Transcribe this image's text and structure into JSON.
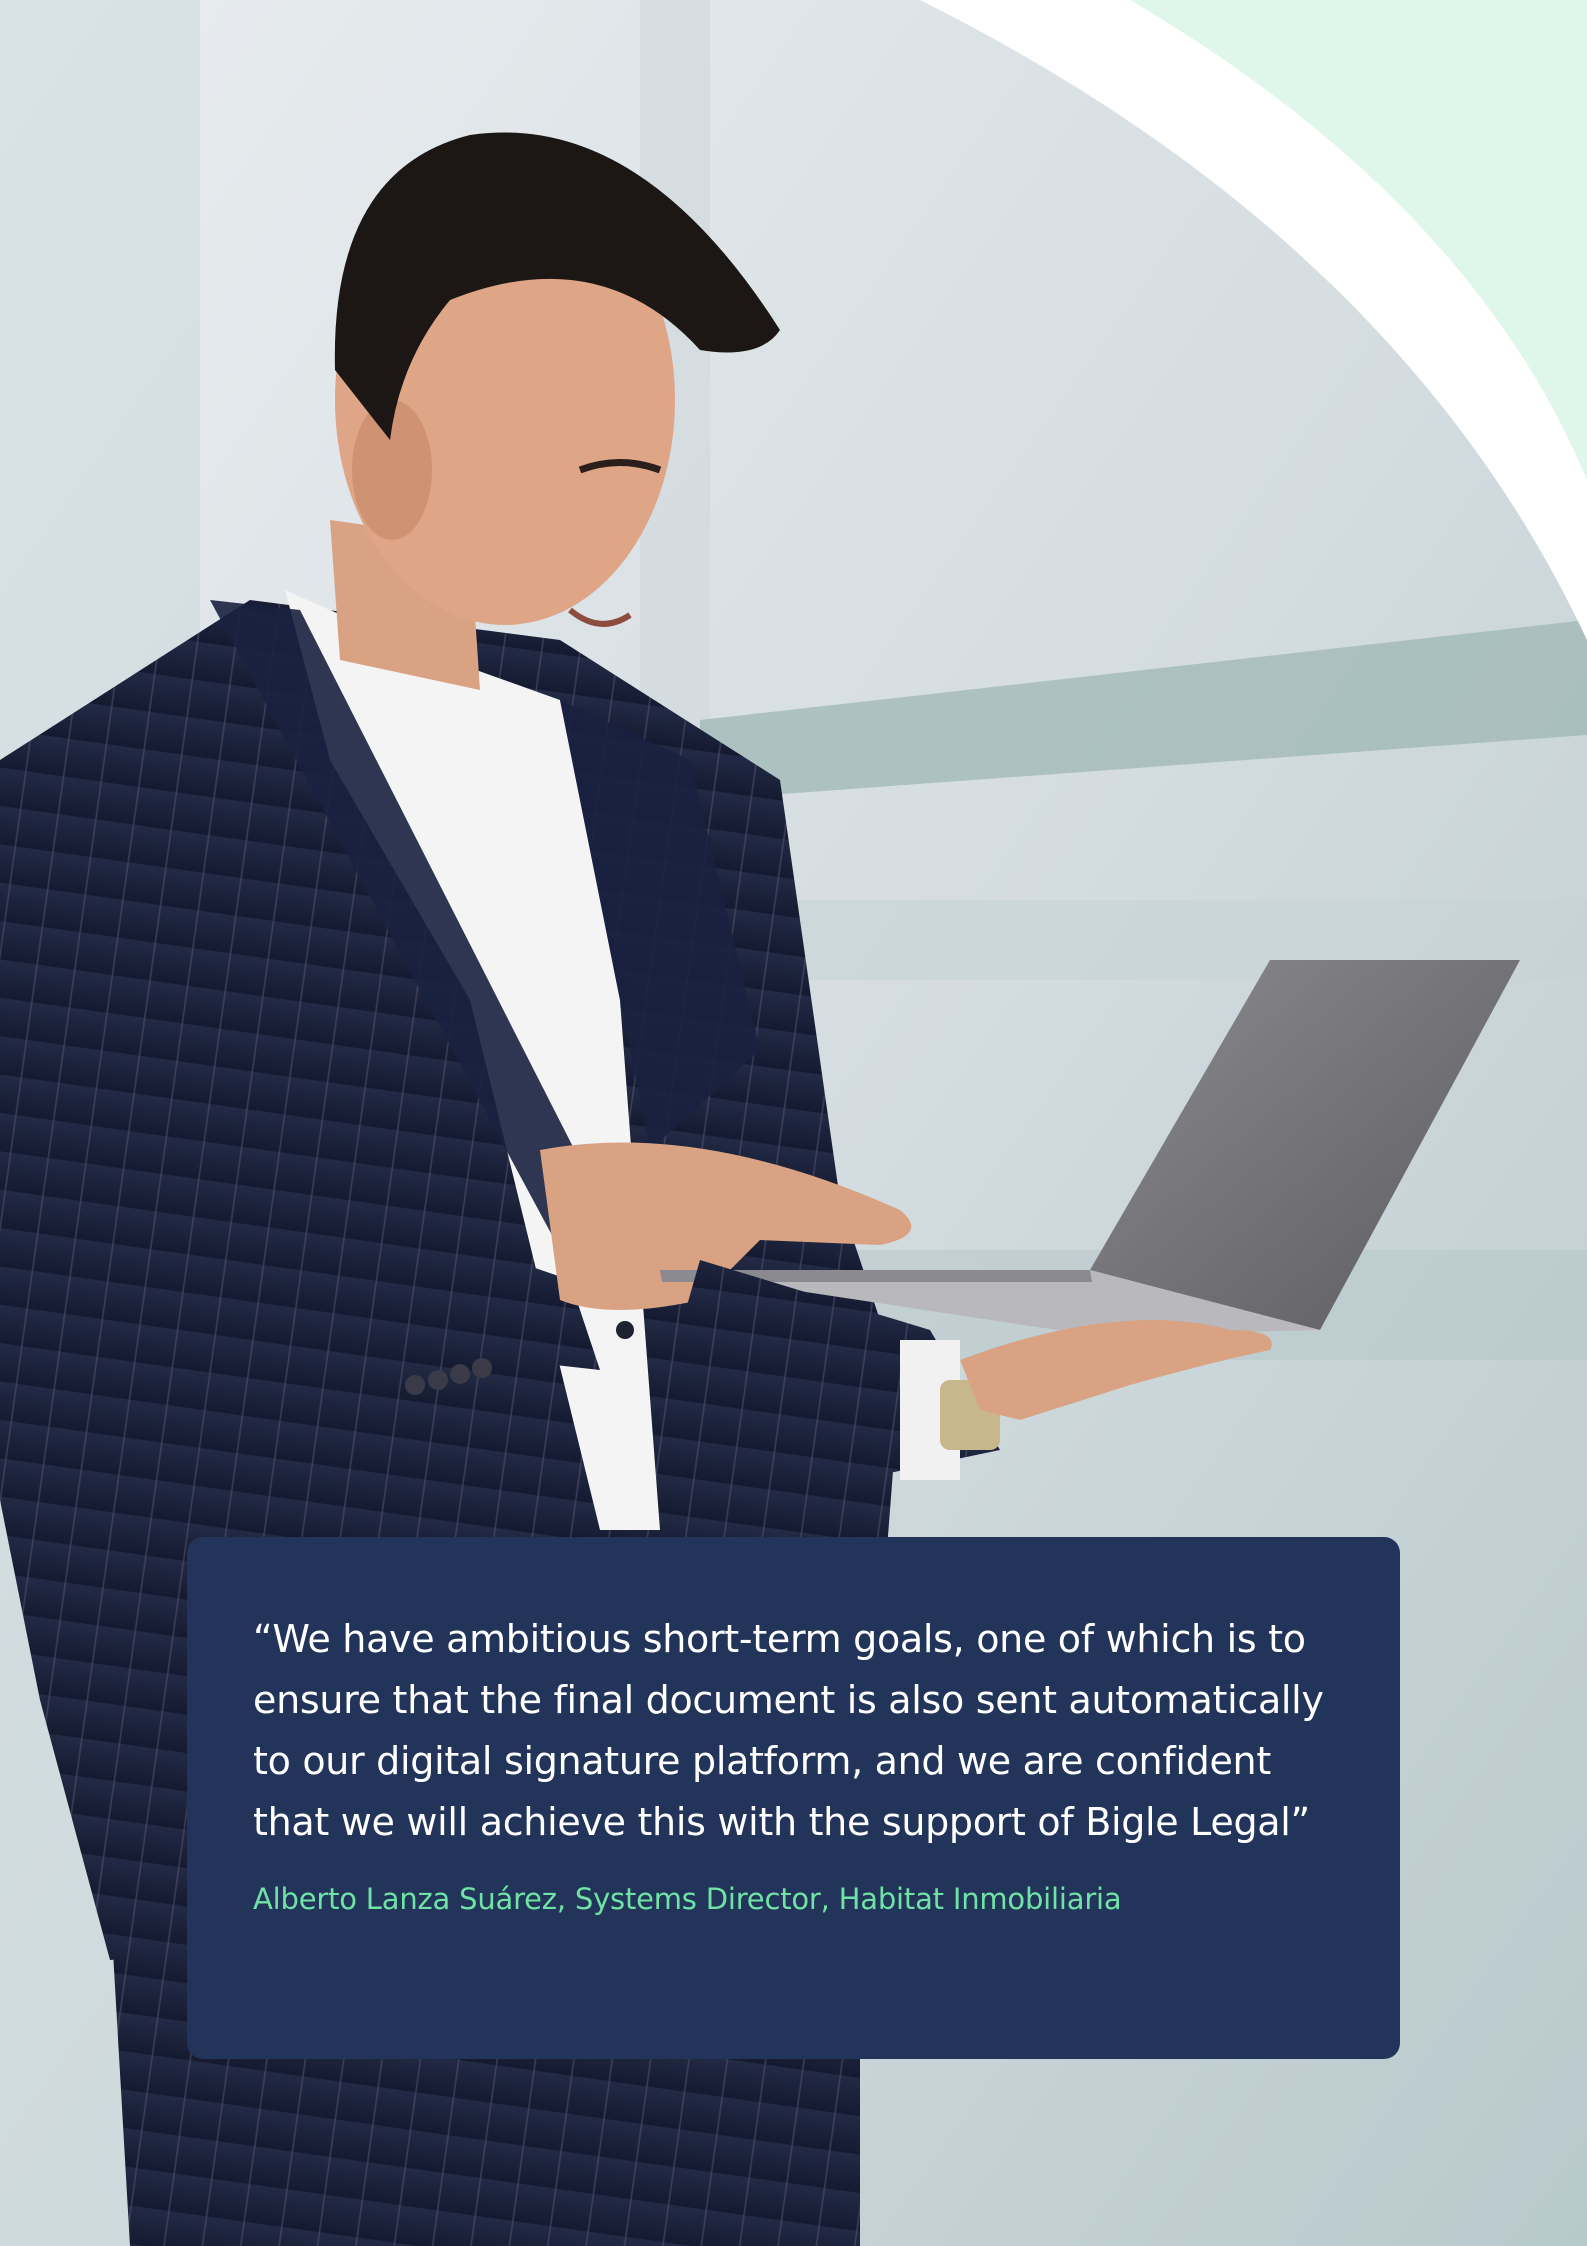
{
  "quote": {
    "text": "“We have ambitious short-term goals, one of which is to ensure that the final document is also sent automatically to our digital signature platform, and we are confident that we will achieve this with the support of Bigle Legal”",
    "attribution": "Alberto Lanza Suárez, Systems Director, Habitat Inmobiliaria"
  },
  "colors": {
    "card_background": "#22345a",
    "quote_text": "#ffffff",
    "attribution_text": "#6fe3a4",
    "mint_arc": "#dff7eb"
  }
}
